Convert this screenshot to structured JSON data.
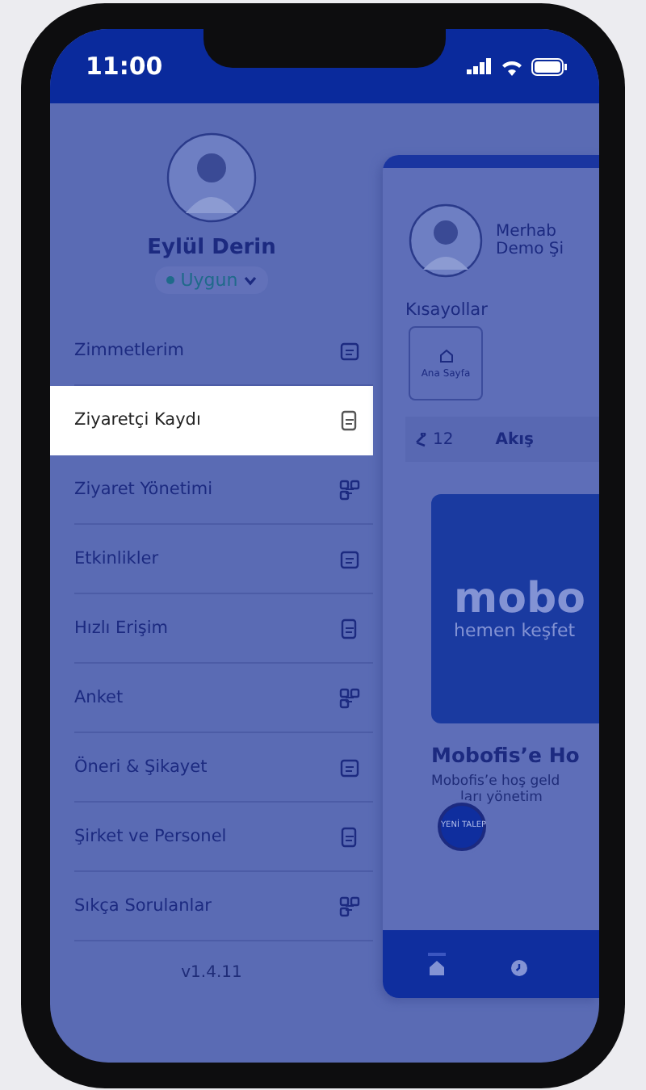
{
  "status_bar": {
    "time": "11:00"
  },
  "profile": {
    "name": "Eylül Derin",
    "status": "Uygun"
  },
  "menu": [
    {
      "label": "Zimmetlerim",
      "selected": false
    },
    {
      "label": "Ziyaretçi Kaydı",
      "selected": true
    },
    {
      "label": "Ziyaret Yönetimi",
      "selected": false
    },
    {
      "label": "Etkinlikler",
      "selected": false
    },
    {
      "label": "Hızlı Erişim",
      "selected": false
    },
    {
      "label": "Anket",
      "selected": false
    },
    {
      "label": "Öneri & Şikayet",
      "selected": false
    },
    {
      "label": "Şirket ve Personel",
      "selected": false
    },
    {
      "label": "Sıkça Sorulanlar",
      "selected": false
    }
  ],
  "version": "v1.4.11",
  "home_preview": {
    "greeting": "Merhab",
    "company": "Demo Şi",
    "shortcuts_title": "Kısayollar",
    "shortcuts": [
      {
        "label": "Ana Sayfa"
      }
    ],
    "tabs": [
      {
        "label": "12",
        "selected": false
      },
      {
        "label": "Akış",
        "selected": true
      }
    ],
    "banner": {
      "logo": "mobo",
      "tagline": "hemen keşfet"
    },
    "article": {
      "title": "Mobofis’e Ho",
      "lines": [
        "Mobofis’e hoş geld",
        "ları yönetim"
      ]
    },
    "fab": "YENİ TALEP",
    "nav": [
      {
        "selected": true
      },
      {
        "selected": false
      }
    ]
  }
}
